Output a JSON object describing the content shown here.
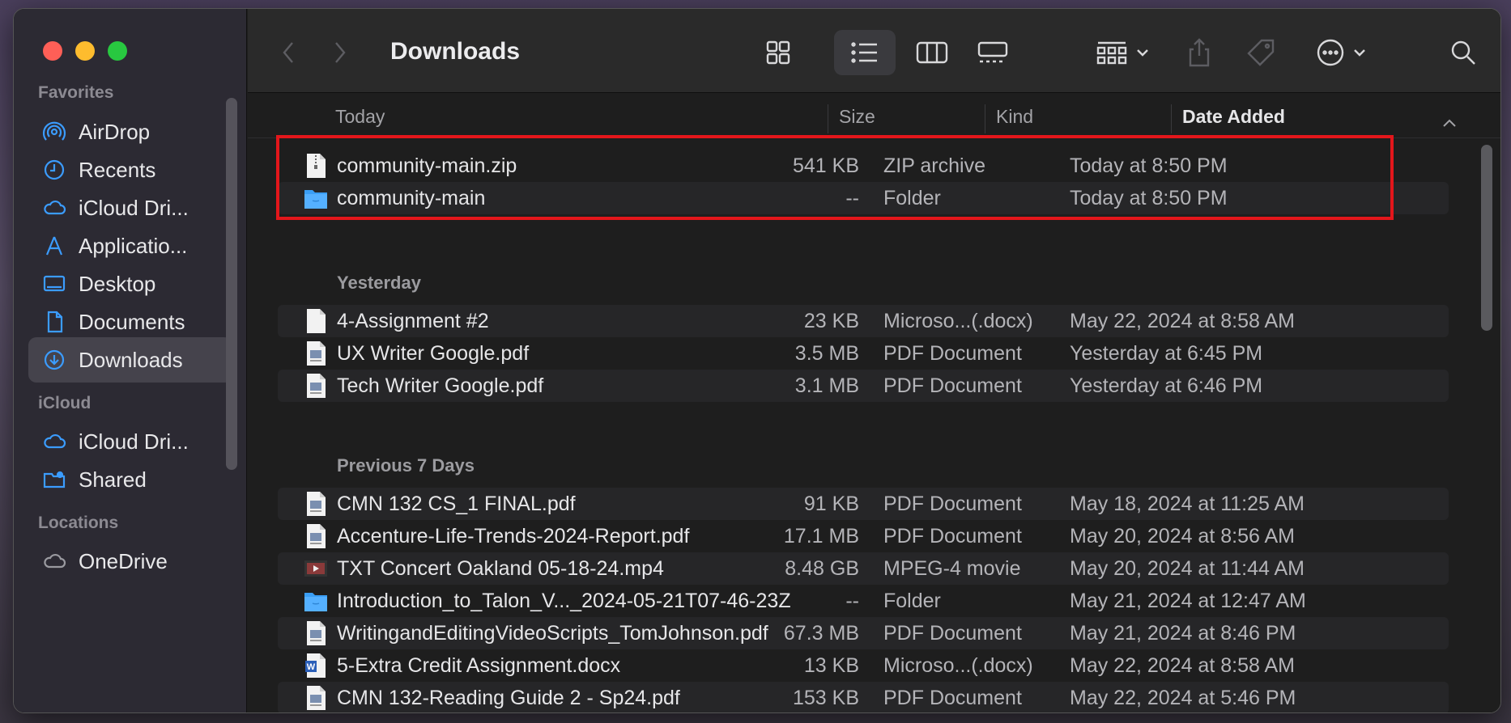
{
  "window": {
    "title": "Downloads"
  },
  "sidebar": {
    "sections": [
      {
        "label": "Favorites"
      },
      {
        "label": "iCloud"
      },
      {
        "label": "Locations"
      }
    ],
    "items": [
      {
        "label": "AirDrop",
        "icon": "airdrop-icon"
      },
      {
        "label": "Recents",
        "icon": "clock-icon"
      },
      {
        "label": "iCloud Dri...",
        "icon": "cloud-icon"
      },
      {
        "label": "Applicatio...",
        "icon": "applications-icon"
      },
      {
        "label": "Desktop",
        "icon": "desktop-icon"
      },
      {
        "label": "Documents",
        "icon": "document-icon"
      },
      {
        "label": "Downloads",
        "icon": "download-icon",
        "active": true
      },
      {
        "label": "iCloud Dri...",
        "icon": "cloud-icon"
      },
      {
        "label": "Shared",
        "icon": "shared-folder-icon"
      },
      {
        "label": "OneDrive",
        "icon": "cloud-icon"
      }
    ]
  },
  "columns": {
    "name": "Today",
    "size": "Size",
    "kind": "Kind",
    "date": "Date Added"
  },
  "groups": [
    {
      "label": "Today"
    },
    {
      "label": "Yesterday"
    },
    {
      "label": "Previous 7 Days"
    }
  ],
  "files": [
    {
      "name": "community-main.zip",
      "size": "541 KB",
      "kind": "ZIP archive",
      "date": "Today at 8:50 PM",
      "icon": "zip-icon"
    },
    {
      "name": "community-main",
      "size": "--",
      "kind": "Folder",
      "date": "Today at 8:50 PM",
      "icon": "folder-icon"
    },
    {
      "name": "4-Assignment #2",
      "size": "23 KB",
      "kind": "Microso...(.docx)",
      "date": "May 22, 2024 at 8:58 AM",
      "icon": "document-icon"
    },
    {
      "name": "UX Writer Google.pdf",
      "size": "3.5 MB",
      "kind": "PDF Document",
      "date": "Yesterday at 6:45 PM",
      "icon": "pdf-icon"
    },
    {
      "name": "Tech Writer Google.pdf",
      "size": "3.1 MB",
      "kind": "PDF Document",
      "date": "Yesterday at 6:46 PM",
      "icon": "pdf-icon"
    },
    {
      "name": "CMN 132 CS_1 FINAL.pdf",
      "size": "91 KB",
      "kind": "PDF Document",
      "date": "May 18, 2024 at 11:25 AM",
      "icon": "pdf-icon"
    },
    {
      "name": "Accenture-Life-Trends-2024-Report.pdf",
      "size": "17.1 MB",
      "kind": "PDF Document",
      "date": "May 20, 2024 at 8:56 AM",
      "icon": "pdf-icon"
    },
    {
      "name": "TXT Concert Oakland 05-18-24.mp4",
      "size": "8.48 GB",
      "kind": "MPEG-4 movie",
      "date": "May 20, 2024 at 11:44 AM",
      "icon": "video-icon"
    },
    {
      "name": "Introduction_to_Talon_V..._2024-05-21T07-46-23Z",
      "size": "--",
      "kind": "Folder",
      "date": "May 21, 2024 at 12:47 AM",
      "icon": "folder-icon"
    },
    {
      "name": "WritingandEditingVideoScripts_TomJohnson.pdf",
      "size": "67.3 MB",
      "kind": "PDF Document",
      "date": "May 21, 2024 at 8:46 PM",
      "icon": "pdf-icon"
    },
    {
      "name": "5-Extra Credit Assignment.docx",
      "size": "13 KB",
      "kind": "Microso...(.docx)",
      "date": "May 22, 2024 at 8:58 AM",
      "icon": "word-doc-icon"
    },
    {
      "name": "CMN 132-Reading Guide 2 - Sp24.pdf",
      "size": "153 KB",
      "kind": "PDF Document",
      "date": "May 22, 2024 at 5:46 PM",
      "icon": "pdf-icon"
    }
  ],
  "colors": {
    "highlight": "#e3161b",
    "accent": "#3b9cff"
  }
}
